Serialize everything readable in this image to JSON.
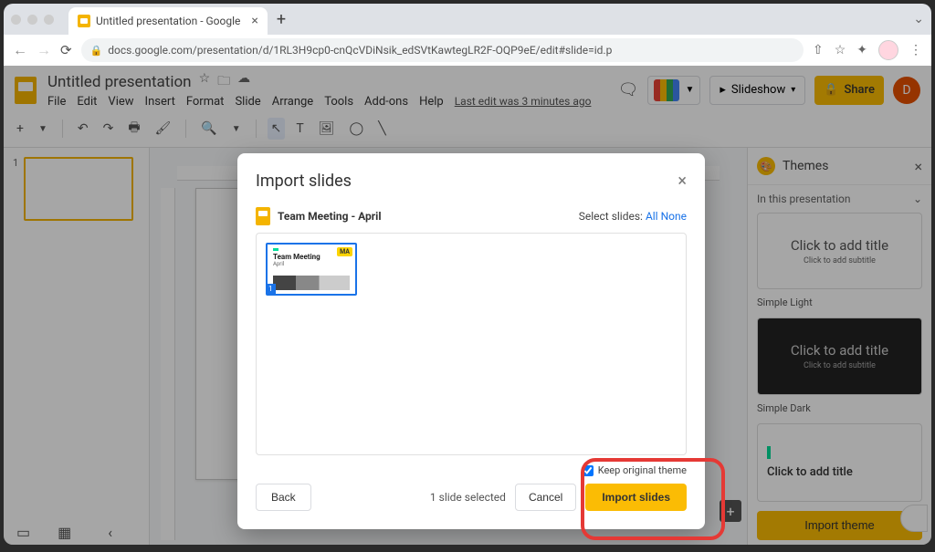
{
  "browser": {
    "tab_title": "Untitled presentation - Google",
    "url": "docs.google.com/presentation/d/1RL3H9cp0-cnQcVDiNsik_edSVtKawtegLR2F-OQP9eE/edit#slide=id.p"
  },
  "app": {
    "doc_title": "Untitled presentation",
    "menus": [
      "File",
      "Edit",
      "View",
      "Insert",
      "Format",
      "Slide",
      "Arrange",
      "Tools",
      "Add-ons",
      "Help"
    ],
    "last_edit": "Last edit was 3 minutes ago",
    "slideshow_btn": "Slideshow",
    "share_btn": "Share",
    "user_initial": "D",
    "slide_placeholder_title": "Click to add title",
    "slide_placeholder_sub": "Click to add subtitle"
  },
  "themes": {
    "title": "Themes",
    "section": "In this presentation",
    "items": [
      {
        "name": "Simple Light",
        "card_title": "Click to add title",
        "card_sub": "Click to add subtitle",
        "variant": "light"
      },
      {
        "name": "Simple Dark",
        "card_title": "Click to add title",
        "card_sub": "Click to add subtitle",
        "variant": "dark"
      },
      {
        "name": "",
        "card_title": "Click to add title",
        "card_sub": "",
        "variant": "accent"
      }
    ],
    "import_btn": "Import theme"
  },
  "dialog": {
    "title": "Import slides",
    "source_name": "Team Meeting - April",
    "select_label": "Select slides:",
    "select_all": "All",
    "select_none": "None",
    "slide_thumb": {
      "badge": "MA",
      "title": "Team Meeting",
      "sub": "April",
      "number": "1"
    },
    "back_btn": "Back",
    "selected_count": "1 slide selected",
    "keep_theme": "Keep original theme",
    "cancel_btn": "Cancel",
    "import_btn": "Import slides"
  }
}
